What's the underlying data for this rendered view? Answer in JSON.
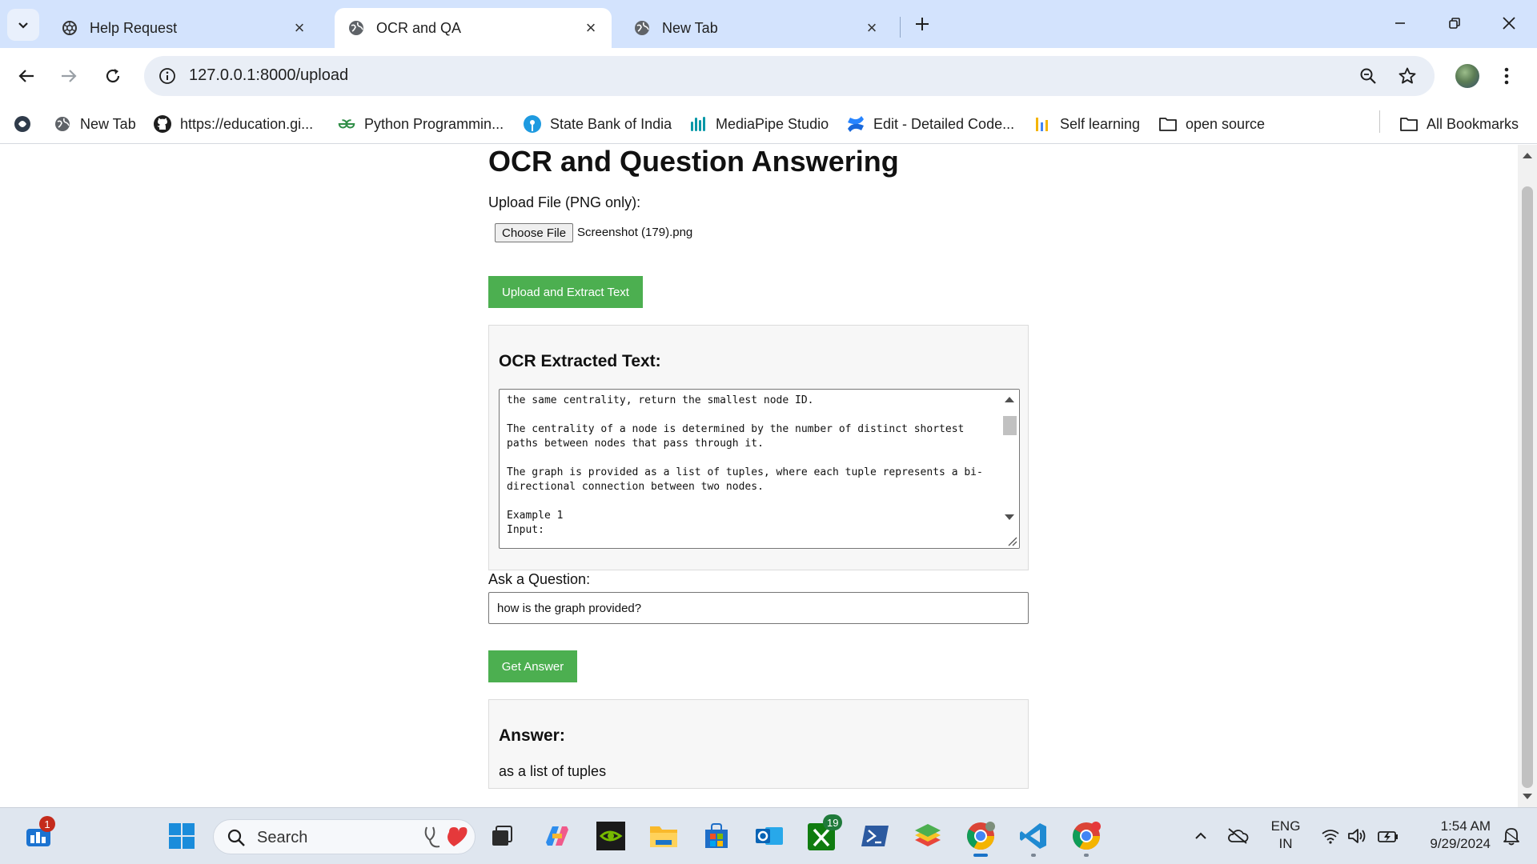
{
  "browser": {
    "tabs": [
      {
        "title": "Help Request",
        "active": false
      },
      {
        "title": "OCR and QA",
        "active": true
      },
      {
        "title": "New Tab",
        "active": false
      }
    ],
    "url": "127.0.0.1:8000/upload"
  },
  "bookmarks": [
    {
      "label": ""
    },
    {
      "label": "New Tab"
    },
    {
      "label": "https://education.gi..."
    },
    {
      "label": "Python Programmin..."
    },
    {
      "label": "State Bank of India"
    },
    {
      "label": "MediaPipe Studio"
    },
    {
      "label": "Edit - Detailed Code..."
    },
    {
      "label": "Self learning"
    },
    {
      "label": "open source"
    }
  ],
  "all_bookmarks_label": "All Bookmarks",
  "page": {
    "title": "OCR and Question Answering",
    "upload_label": "Upload File (PNG only):",
    "choose_file_label": "Choose File",
    "file_name": "Screenshot (179).png",
    "upload_button": "Upload and Extract Text",
    "ocr_heading": "OCR Extracted Text:",
    "ocr_text": "the same centrality, return the smallest node ID.\n\nThe centrality of a node is determined by the number of distinct shortest paths between nodes that pass through it.\n\nThe graph is provided as a list of tuples, where each tuple represents a bi-\ndirectional connection between two nodes.\n\nExample 1\nInput:",
    "question_label": "Ask a Question:",
    "question_value": "how is the graph provided?",
    "answer_button": "Get Answer",
    "answer_heading": "Answer:",
    "answer_text": "as a list of tuples"
  },
  "taskbar": {
    "search_placeholder": "Search",
    "widgets_badge": "1",
    "xbox_badge": "19",
    "language_line1": "ENG",
    "language_line2": "IN",
    "time": "1:54 AM",
    "date": "9/29/2024"
  },
  "colors": {
    "accent_green": "#4caf50",
    "tabstrip": "#d3e3fd",
    "omnibox": "#e9eef6"
  }
}
